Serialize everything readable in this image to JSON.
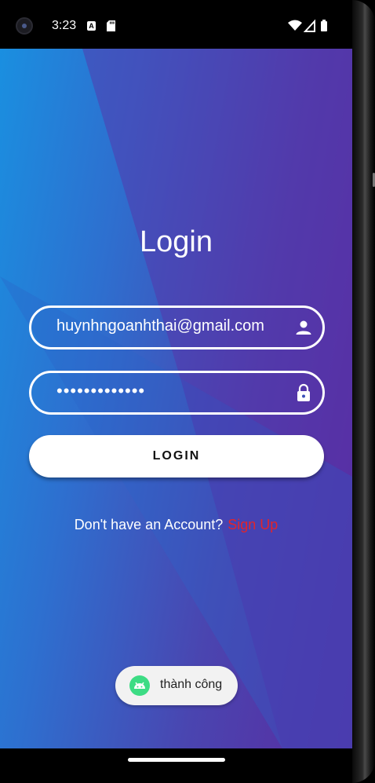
{
  "status_bar": {
    "time": "3:23",
    "notification_icons": [
      "keyboard-a-icon",
      "sd-card-icon"
    ],
    "system_icons": [
      "wifi-icon",
      "signal-icon",
      "battery-icon"
    ]
  },
  "login": {
    "title": "Login",
    "email": {
      "value": "huynhngoanhthai@gmail.com",
      "icon": "person-icon"
    },
    "password": {
      "value": "•••••••••••••",
      "icon": "lock-icon"
    },
    "login_button": "LOGIN",
    "signup_prompt": "Don't have an Account?",
    "signup_link": "Sign Up"
  },
  "toast": {
    "icon": "android-icon",
    "message": "thành công"
  },
  "colors": {
    "gradient_start": "#1a8fe0",
    "gradient_end": "#5a2aa0",
    "signup_link": "#e3242b",
    "button_bg": "#ffffff"
  }
}
